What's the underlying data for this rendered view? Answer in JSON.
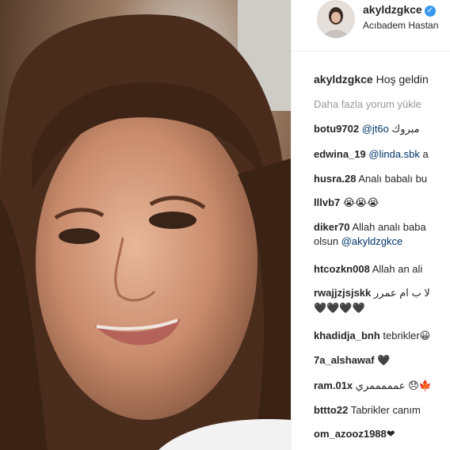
{
  "post": {
    "username": "akyldzgkce",
    "location": "Acıbadem Hastan",
    "caption_user": "akyldzgkce",
    "caption_text": "Hoş geldin",
    "load_more": "Daha fazla yorum yükle"
  },
  "comments": [
    {
      "user": "botu9702",
      "mention": "@jt6o",
      "text": " مبروك"
    },
    {
      "user": "edwina_19",
      "mention": "@linda.sbk",
      "text": " a"
    },
    {
      "user": "husra.28",
      "mention": "",
      "text": " Analı babalı bu"
    },
    {
      "user": "lllvb7",
      "mention": "",
      "text": " 😭😭😭"
    },
    {
      "user": "diker70",
      "mention": "",
      "text": " Allah analı baba",
      "text2": "olsun ",
      "mention2": "@akyldzgkce"
    },
    {
      "user": "htcozkn008",
      "mention": "",
      "text": " Allah an ali"
    },
    {
      "user": "rwajjzjsjskk",
      "mention": "",
      "text": " لا ب ام عمرر",
      "text2": "🖤🖤🖤🖤"
    },
    {
      "user": "khadidja_bnh",
      "mention": "",
      "text": " tebrikler😀"
    },
    {
      "user": "7a_alshawaf",
      "mention": "",
      "text": " 🖤"
    },
    {
      "user": "ram.01x",
      "mention": "",
      "text": " عمممممري 😞🍁"
    },
    {
      "user": "bttto22",
      "mention": "",
      "text": " Tabrikler canım"
    },
    {
      "user": "om_azooz1988",
      "mention": "",
      "text": "❤"
    }
  ],
  "colors": {
    "accent": "#3897f0",
    "mention": "#003569",
    "muted": "#999999"
  },
  "icons": {
    "verified": "verified-badge-icon"
  }
}
